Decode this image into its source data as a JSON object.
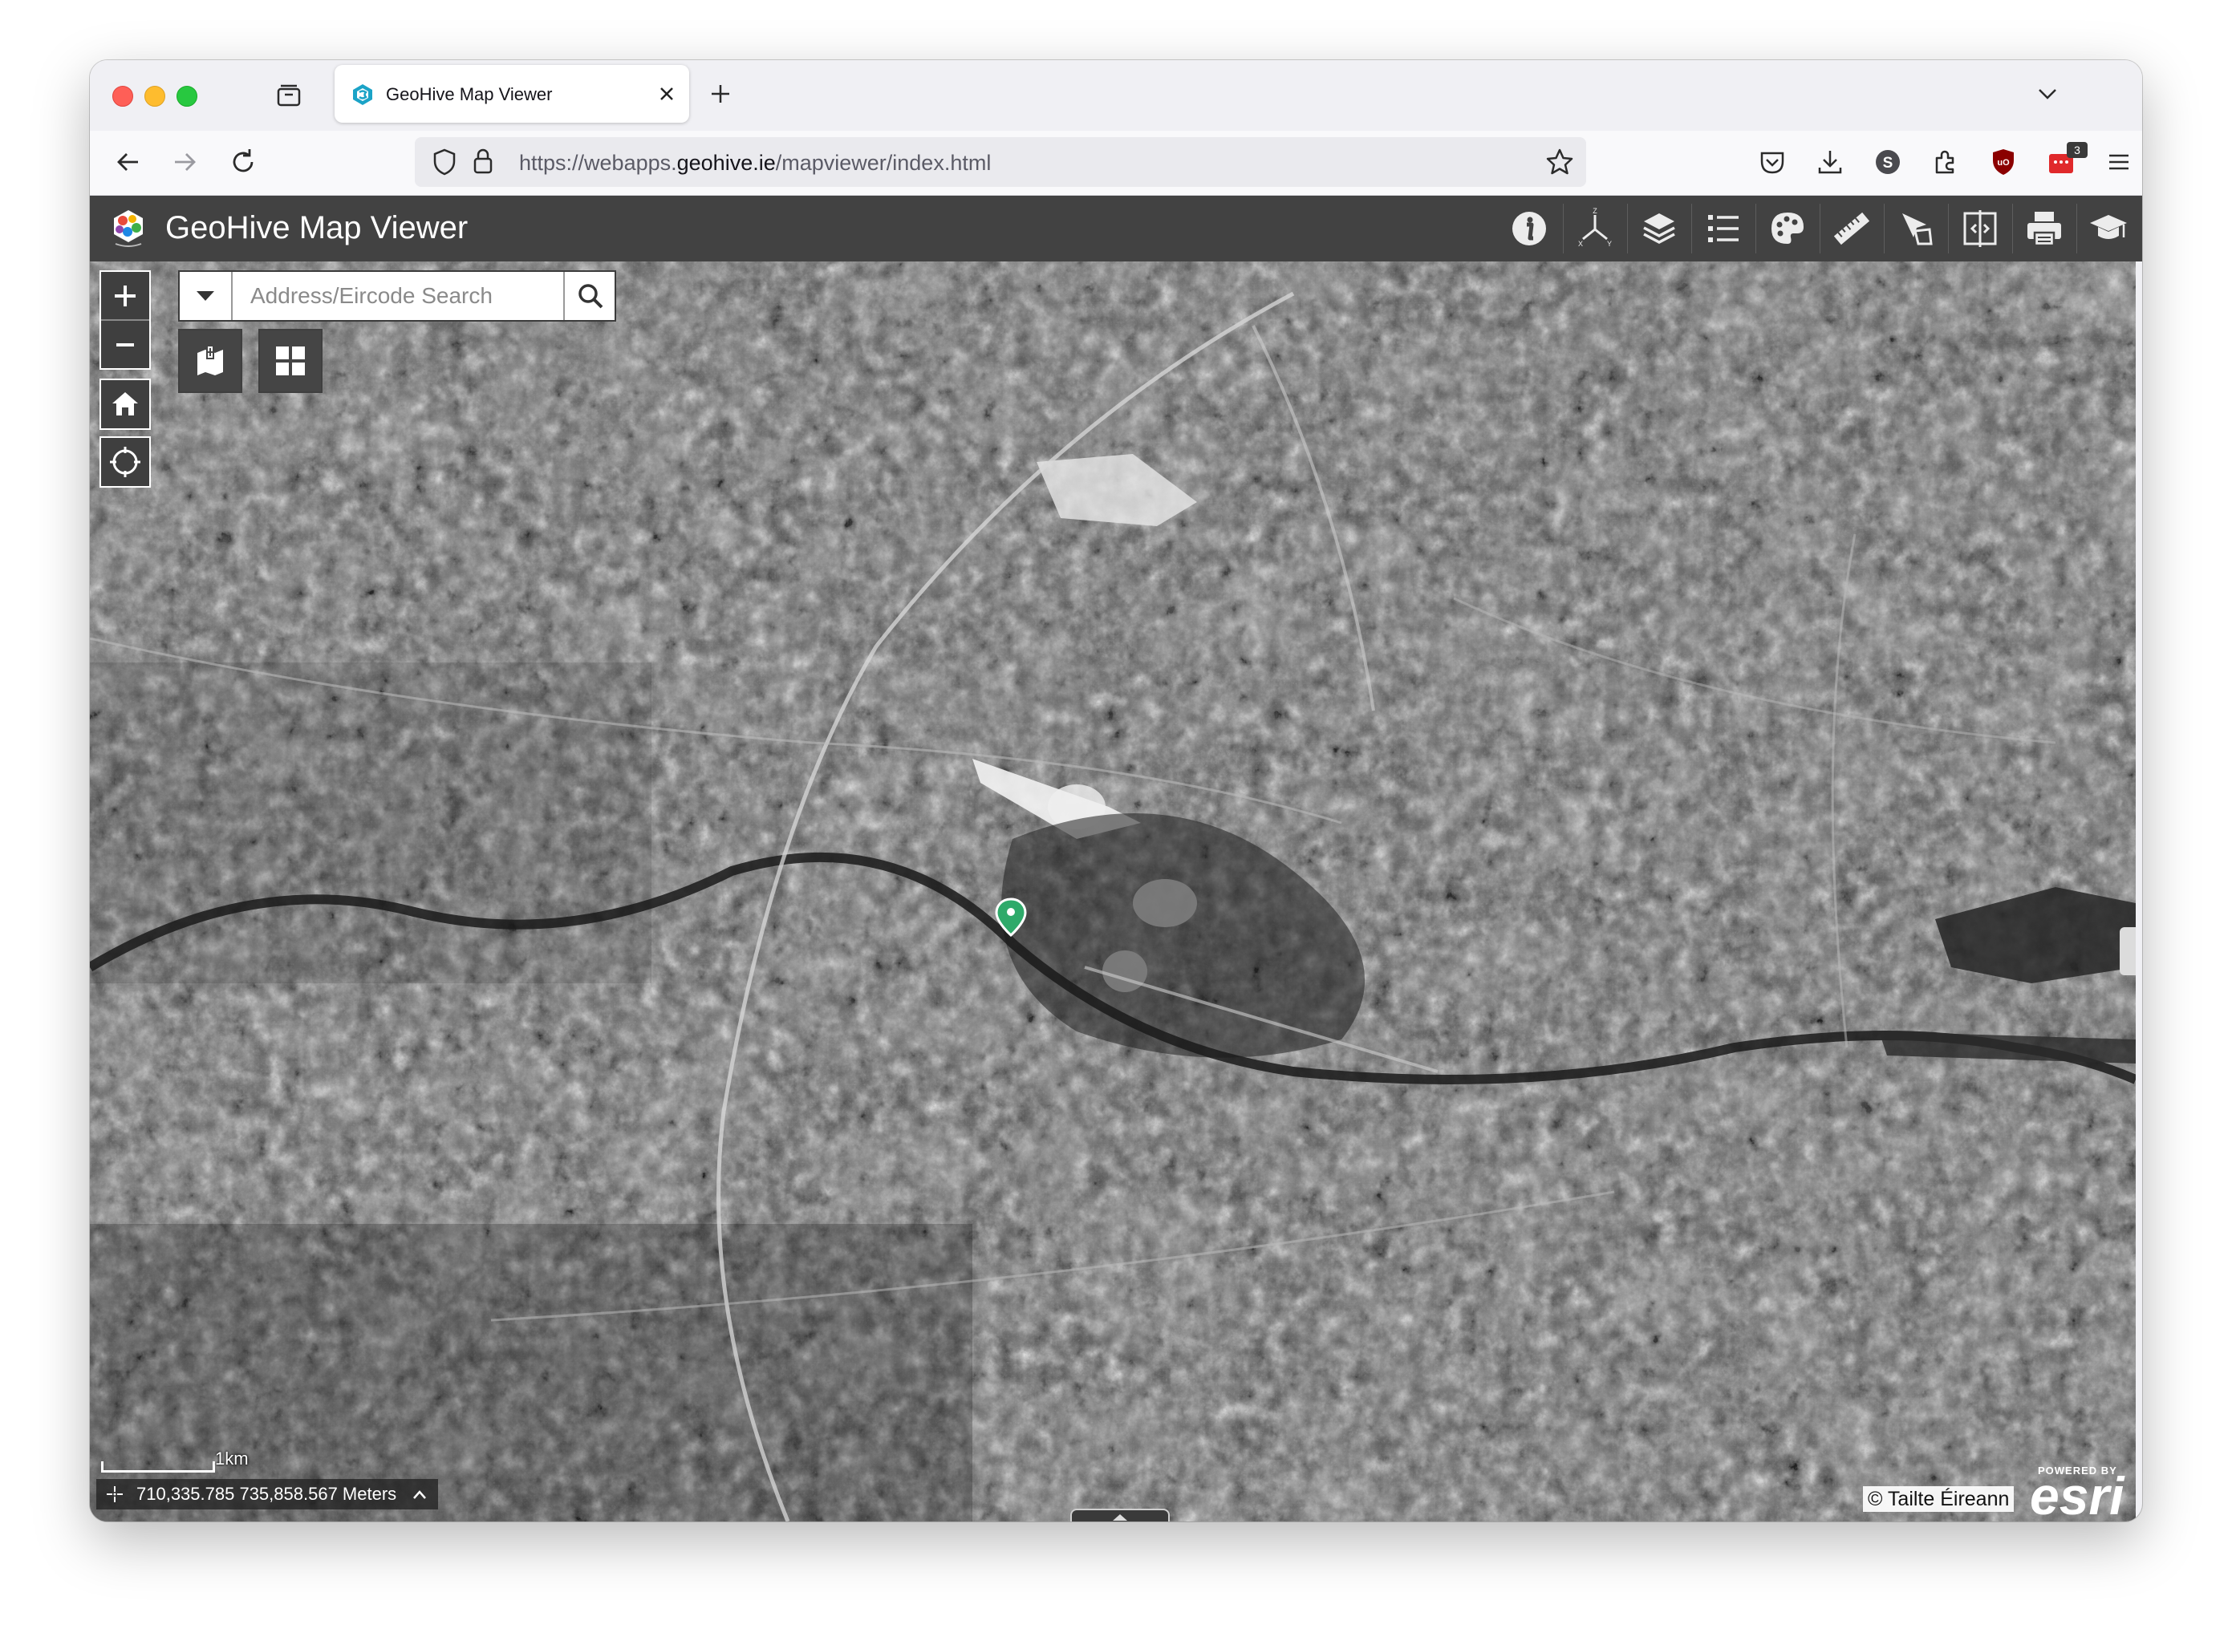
{
  "browser": {
    "tab": {
      "title": "GeoHive Map Viewer"
    },
    "url": {
      "prefix": "https://webapps.",
      "domain": "geohive.ie",
      "path": "/mapviewer/index.html"
    },
    "extension_badge": "3",
    "nav_icons": [
      "back-arrow-icon",
      "forward-arrow-icon",
      "reload-icon",
      "shield-icon",
      "lock-icon",
      "bookmark-star-icon",
      "pocket-icon",
      "download-icon",
      "account-icon",
      "extensions-icon",
      "ublock-icon",
      "extension-badge-icon",
      "menu-icon"
    ]
  },
  "app": {
    "title": "GeoHive Map Viewer",
    "header_color": "#424242",
    "toolbar_icons": [
      "info-icon",
      "coordinate-axes-icon",
      "layers-icon",
      "legend-list-icon",
      "basemap-palette-icon",
      "measure-ruler-icon",
      "draw-icon",
      "swipe-compare-icon",
      "print-icon",
      "education-cap-icon"
    ]
  },
  "map": {
    "search": {
      "placeholder": "Address/Eircode Search"
    },
    "coordinates": "710,335.785 735,858.567 Meters",
    "scale_label": "1km",
    "attribution": "© Tailte Éireann",
    "esri": {
      "powered_by": "POWERED BY",
      "logo": "esri"
    },
    "marker_color": "#2eaa6a",
    "left_controls": [
      "zoom-in-icon",
      "zoom-out-icon",
      "home-icon",
      "locate-icon"
    ]
  }
}
